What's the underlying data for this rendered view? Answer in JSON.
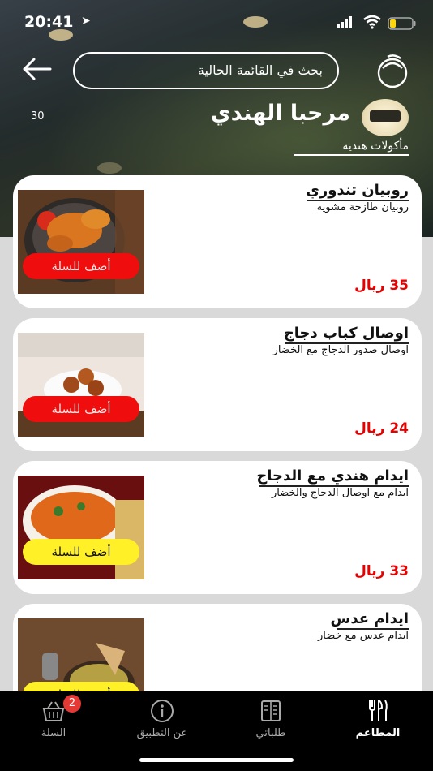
{
  "status_bar": {
    "time": "20:41"
  },
  "header": {
    "search_placeholder": "بحث في القائمة الحالية",
    "count": "30",
    "restaurant_name": "مرحبا الهندي",
    "restaurant_category": "مأكولات هنديه"
  },
  "menu_items": [
    {
      "title": "روبيان تندوري",
      "description": "روبيان طازجة مشويه",
      "price": "35 ريال",
      "add_label": "أضف للسلة",
      "button_color": "#f00d0d"
    },
    {
      "title": "اوصال كباب دجاج",
      "description": "اوصال صدور الدجاج مع الخضار",
      "price": "24 ريال",
      "add_label": "أضف للسلة",
      "button_color": "#f00d0d"
    },
    {
      "title": "ايدام هندي مع الدجاج",
      "description": "ايدام مع اوصال الدجاج والخضار",
      "price": "33 ريال",
      "add_label": "أضف للسلة",
      "button_color": "#fff028"
    },
    {
      "title": "ايدام عدس",
      "description": "ايدام عدس مع خضار",
      "price": "",
      "add_label": "أضف للسلة",
      "button_color": "#fff028"
    }
  ],
  "bottom_nav": {
    "cart": {
      "label": "السلة",
      "icon": "basket-icon",
      "badge": "2"
    },
    "about": {
      "label": "عن التطبيق",
      "icon": "info-icon"
    },
    "orders": {
      "label": "طلباتي",
      "icon": "menu-book-icon"
    },
    "restaurants": {
      "label": "المطاعم",
      "icon": "fork-knife-icon"
    }
  },
  "colors": {
    "price": "#e60000",
    "nav_bg": "#000000",
    "badge": "#e53935"
  }
}
